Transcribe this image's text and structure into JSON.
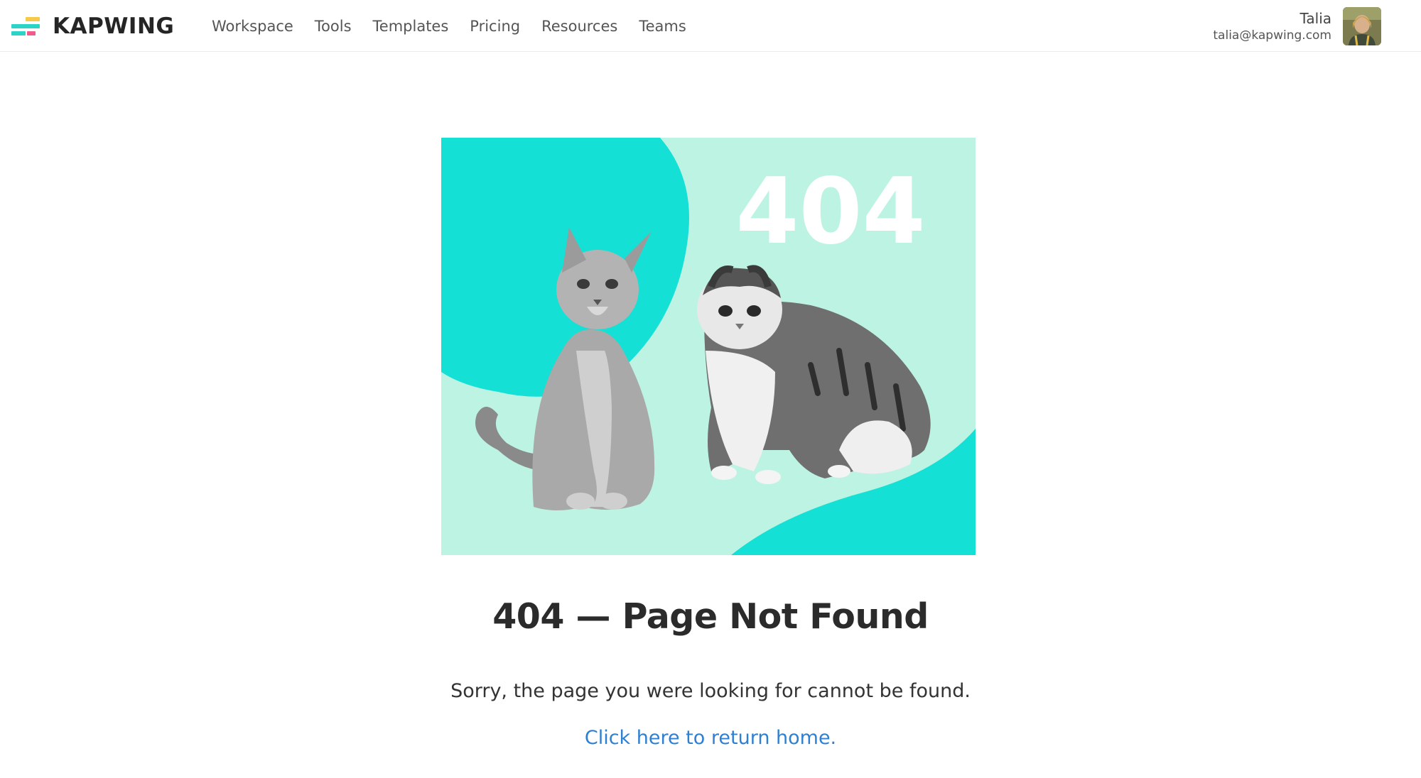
{
  "header": {
    "brand": "KAPWING",
    "brand_colors": [
      "#f6c94a",
      "#2cd3c7",
      "#f15b8c"
    ],
    "nav": [
      {
        "label": "Workspace"
      },
      {
        "label": "Tools"
      },
      {
        "label": "Templates"
      },
      {
        "label": "Pricing"
      },
      {
        "label": "Resources"
      },
      {
        "label": "Teams"
      }
    ],
    "user": {
      "name": "Talia",
      "email": "talia@kapwing.com"
    }
  },
  "hero": {
    "badge_text": "404",
    "colors": {
      "background": "#bdf3e2",
      "accent": "#15e0d6"
    }
  },
  "content": {
    "title": "404 — Page Not Found",
    "message": "Sorry, the page you were looking for cannot be found.",
    "home_link": "Click here to return home.",
    "link_color": "#2f80d0"
  }
}
